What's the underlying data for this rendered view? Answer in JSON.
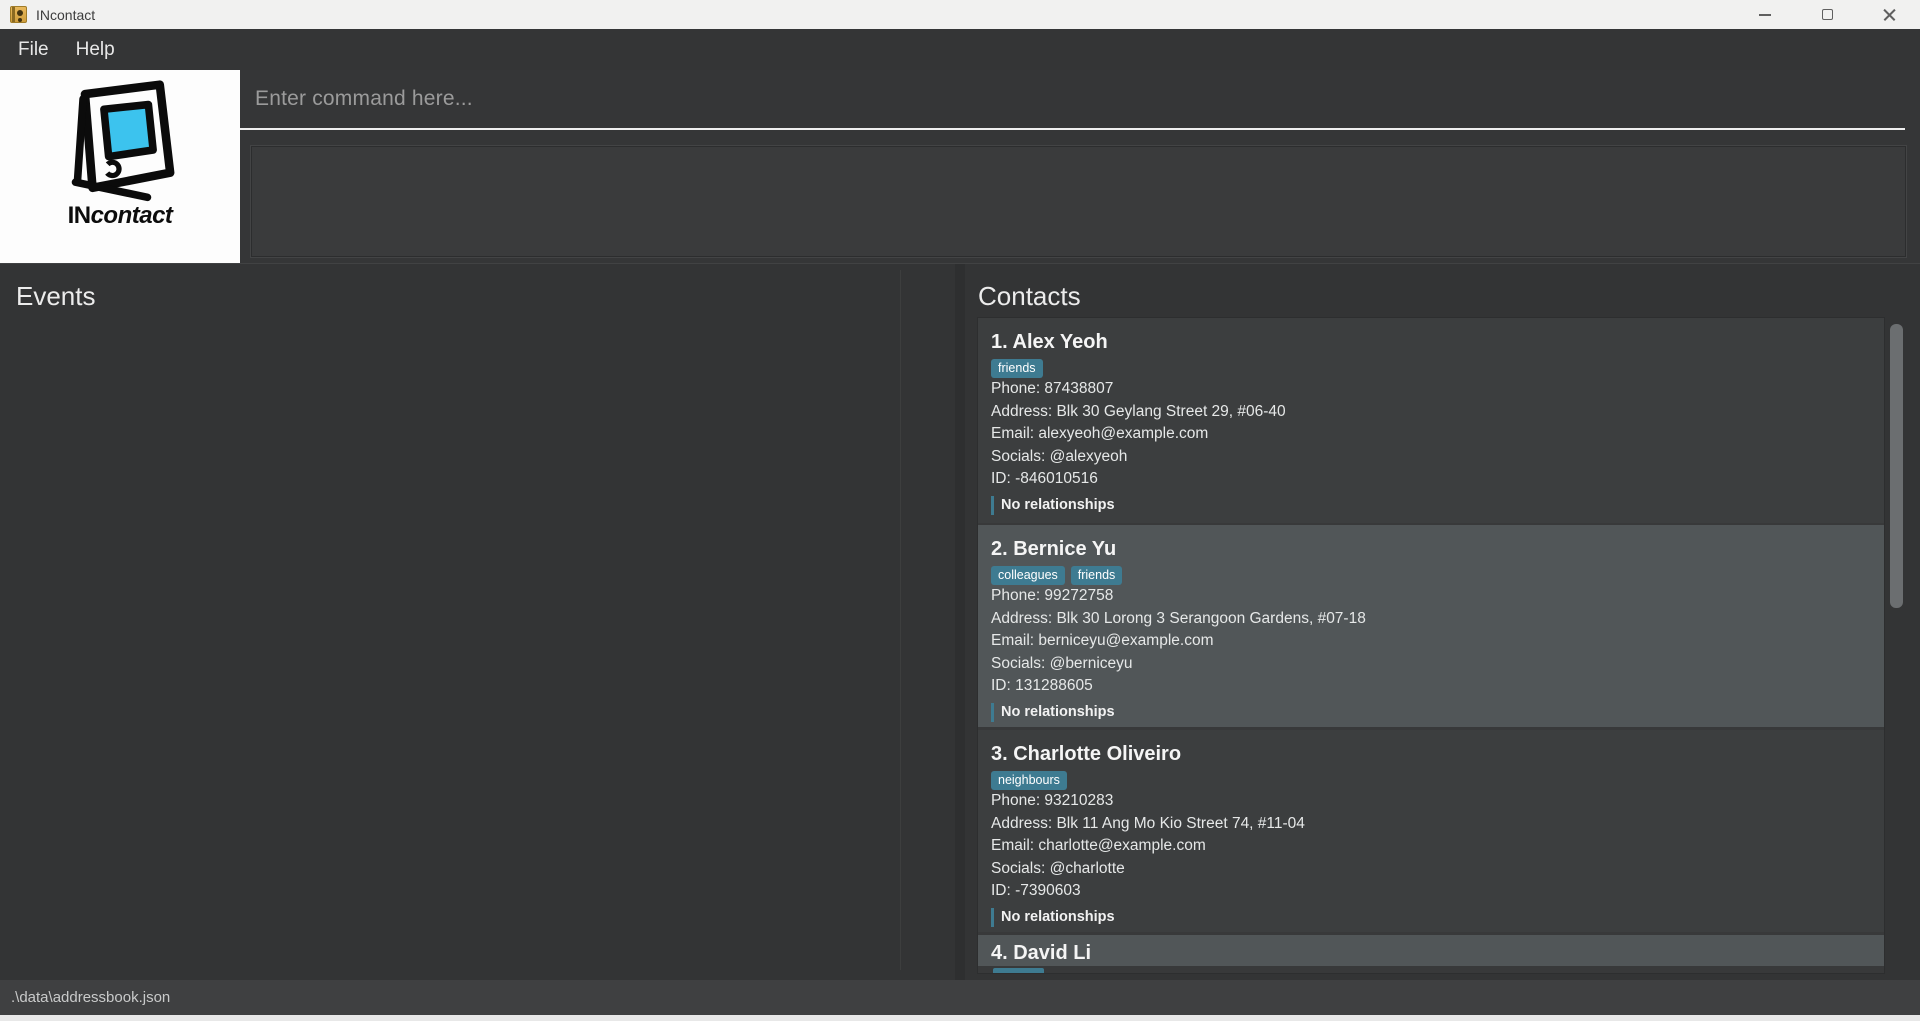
{
  "window": {
    "title": "INcontact"
  },
  "menu": {
    "items": {
      "file": "File",
      "help": "Help"
    }
  },
  "logo": {
    "text_regular": "IN",
    "text_italic": "contact"
  },
  "command_box": {
    "placeholder": "Enter command here..."
  },
  "events_panel": {
    "title": "Events"
  },
  "contacts_panel": {
    "title": "Contacts",
    "contacts": [
      {
        "name": "1. Alex Yeoh",
        "tags": [
          "friends"
        ],
        "phone": "Phone: 87438807",
        "address": "Address: Blk 30 Geylang Street 29, #06-40",
        "email": "Email: alexyeoh@example.com",
        "socials": "Socials: @alexyeoh",
        "id": "ID: -846010516",
        "relationships": "No relationships"
      },
      {
        "name": "2. Bernice Yu",
        "tags": [
          "colleagues",
          "friends"
        ],
        "phone": "Phone: 99272758",
        "address": "Address: Blk 30 Lorong 3 Serangoon Gardens, #07-18",
        "email": "Email: berniceyu@example.com",
        "socials": "Socials: @berniceyu",
        "id": "ID: 131288605",
        "relationships": "No relationships"
      },
      {
        "name": "3. Charlotte Oliveiro",
        "tags": [
          "neighbours"
        ],
        "phone": "Phone: 93210283",
        "address": "Address: Blk 11 Ang Mo Kio Street 74, #11-04",
        "email": "Email: charlotte@example.com",
        "socials": "Socials: @charlotte",
        "id": "ID: -7390603",
        "relationships": "No relationships"
      },
      {
        "name": "4. David Li",
        "tags": []
      }
    ]
  },
  "status_bar": {
    "text": ".\\data\\addressbook.json"
  },
  "colors": {
    "tag_background": "#3e7b91",
    "card_even": "#3c3e3f",
    "card_odd": "#515658",
    "logo_screen": "#3cc3ee"
  }
}
